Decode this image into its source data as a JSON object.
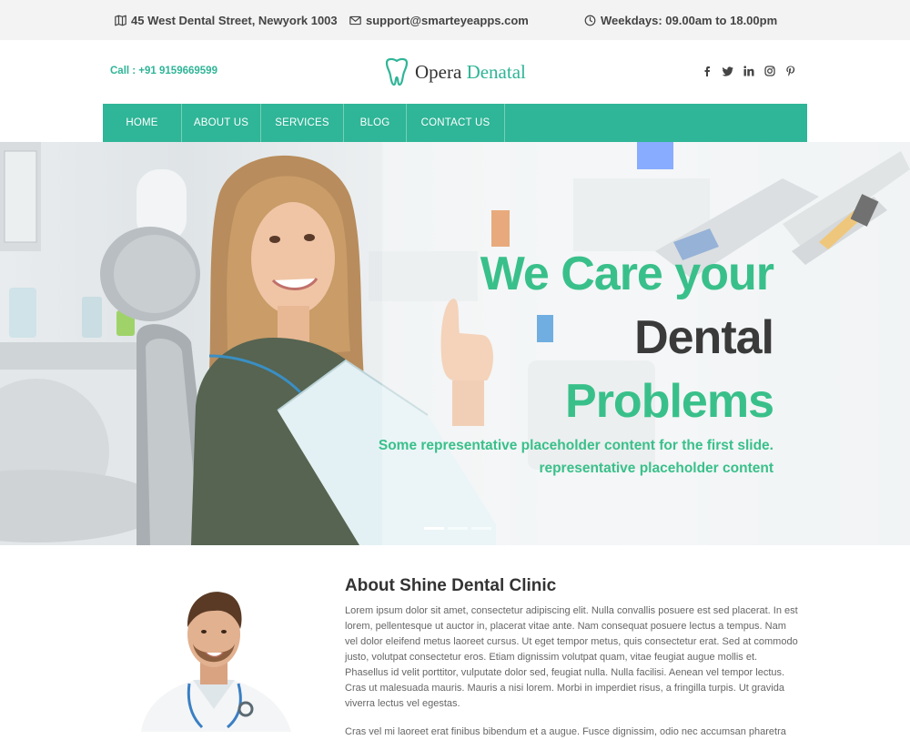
{
  "topbar": {
    "address": "45 West Dental Street, Newyork 1003",
    "email": "support@smarteyeapps.com",
    "hours": "Weekdays: 09.00am to 18.00pm"
  },
  "header": {
    "call": "Call : +91 9159669599",
    "brand_first": "Opera",
    "brand_second": "Denatal",
    "social": [
      "facebook-icon",
      "twitter-icon",
      "linkedin-icon",
      "instagram-icon",
      "pinterest-icon"
    ]
  },
  "nav": {
    "items": [
      "HOME",
      "ABOUT US",
      "SERVICES",
      "BLOG",
      "CONTACT US"
    ]
  },
  "hero": {
    "line1": "We Care your",
    "line2": "Dental",
    "line3": "Problems",
    "sub1": "Some representative placeholder content for the first slide.",
    "sub2": "representative placeholder content",
    "active_slide": 1
  },
  "about": {
    "title": "About Shine Dental Clinic",
    "para1": "Lorem ipsum dolor sit amet, consectetur adipiscing elit. Nulla convallis posuere est sed placerat. In est lorem, pellentesque ut auctor in, placerat vitae ante. Nam consequat posuere lectus a tempus. Nam vel dolor eleifend metus laoreet cursus. Ut eget tempor metus, quis consectetur erat. Sed at commodo justo, volutpat consectetur eros. Etiam dignissim volutpat quam, vitae feugiat augue mollis et. Phasellus id velit porttitor, vulputate dolor sed, feugiat nulla. Nulla facilisi. Aenean vel tempor lectus. Cras ut malesuada mauris. Mauris a nisi lorem. Morbi in imperdiet risus, a fringilla turpis. Ut gravida viverra lectus vel egestas.",
    "para2": "Cras vel mi laoreet erat finibus bibendum et a augue. Fusce dignissim, odio nec accumsan pharetra"
  },
  "colors": {
    "accent": "#2fb597",
    "hero_green": "#39c08a",
    "dark_text": "#3a3a3a",
    "topbar_bg": "#f3f3f3"
  }
}
